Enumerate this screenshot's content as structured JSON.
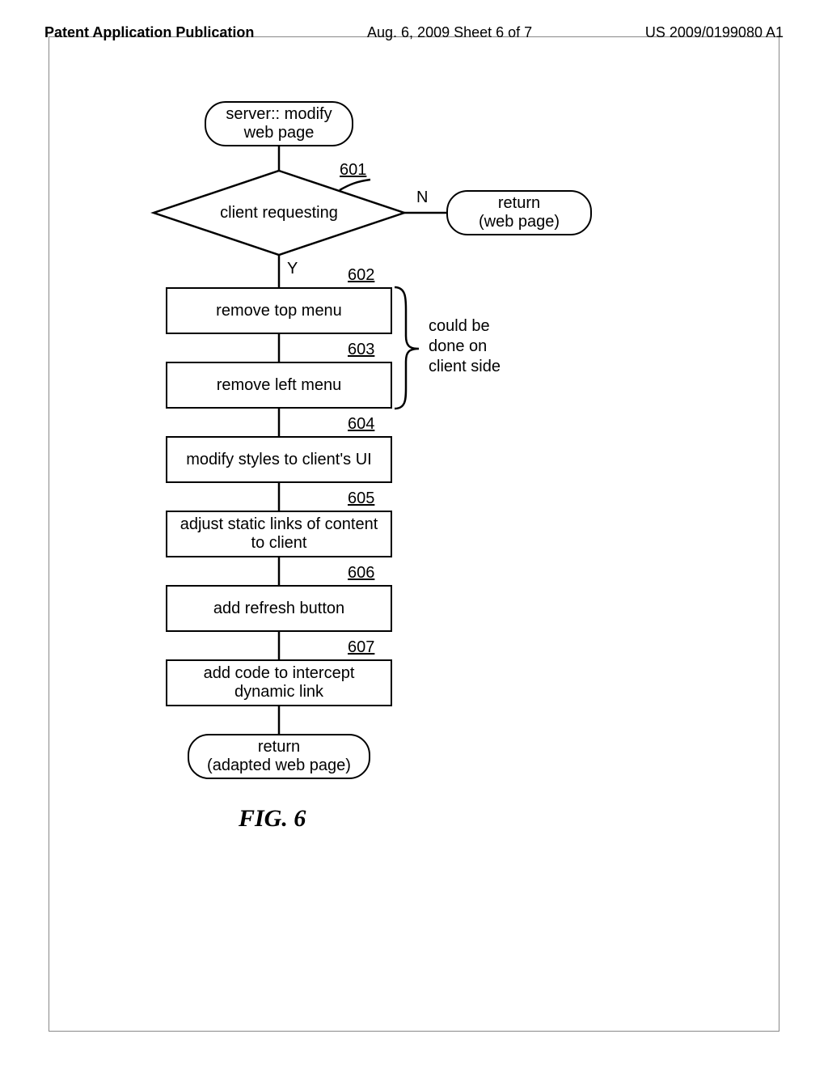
{
  "header": {
    "left": "Patent Application Publication",
    "mid": "Aug. 6, 2009  Sheet 6 of 7",
    "right": "US 2009/0199080 A1"
  },
  "flow": {
    "start": "server:: modify\nweb page",
    "decision": "client requesting",
    "decision_no_label": "N",
    "decision_yes_label": "Y",
    "return_no": "return\n(web page)",
    "step602": "remove top menu",
    "step603": "remove left menu",
    "step604": "modify styles to client's UI",
    "step605": "adjust static links of content to client",
    "step606": "add refresh button",
    "step607": "add code to intercept dynamic link",
    "return_yes": "return\n(adapted web page)",
    "side_note": "could be\ndone on\nclient side"
  },
  "refs": {
    "r601": "601",
    "r602": "602",
    "r603": "603",
    "r604": "604",
    "r605": "605",
    "r606": "606",
    "r607": "607"
  },
  "figure_caption": "FIG. 6"
}
